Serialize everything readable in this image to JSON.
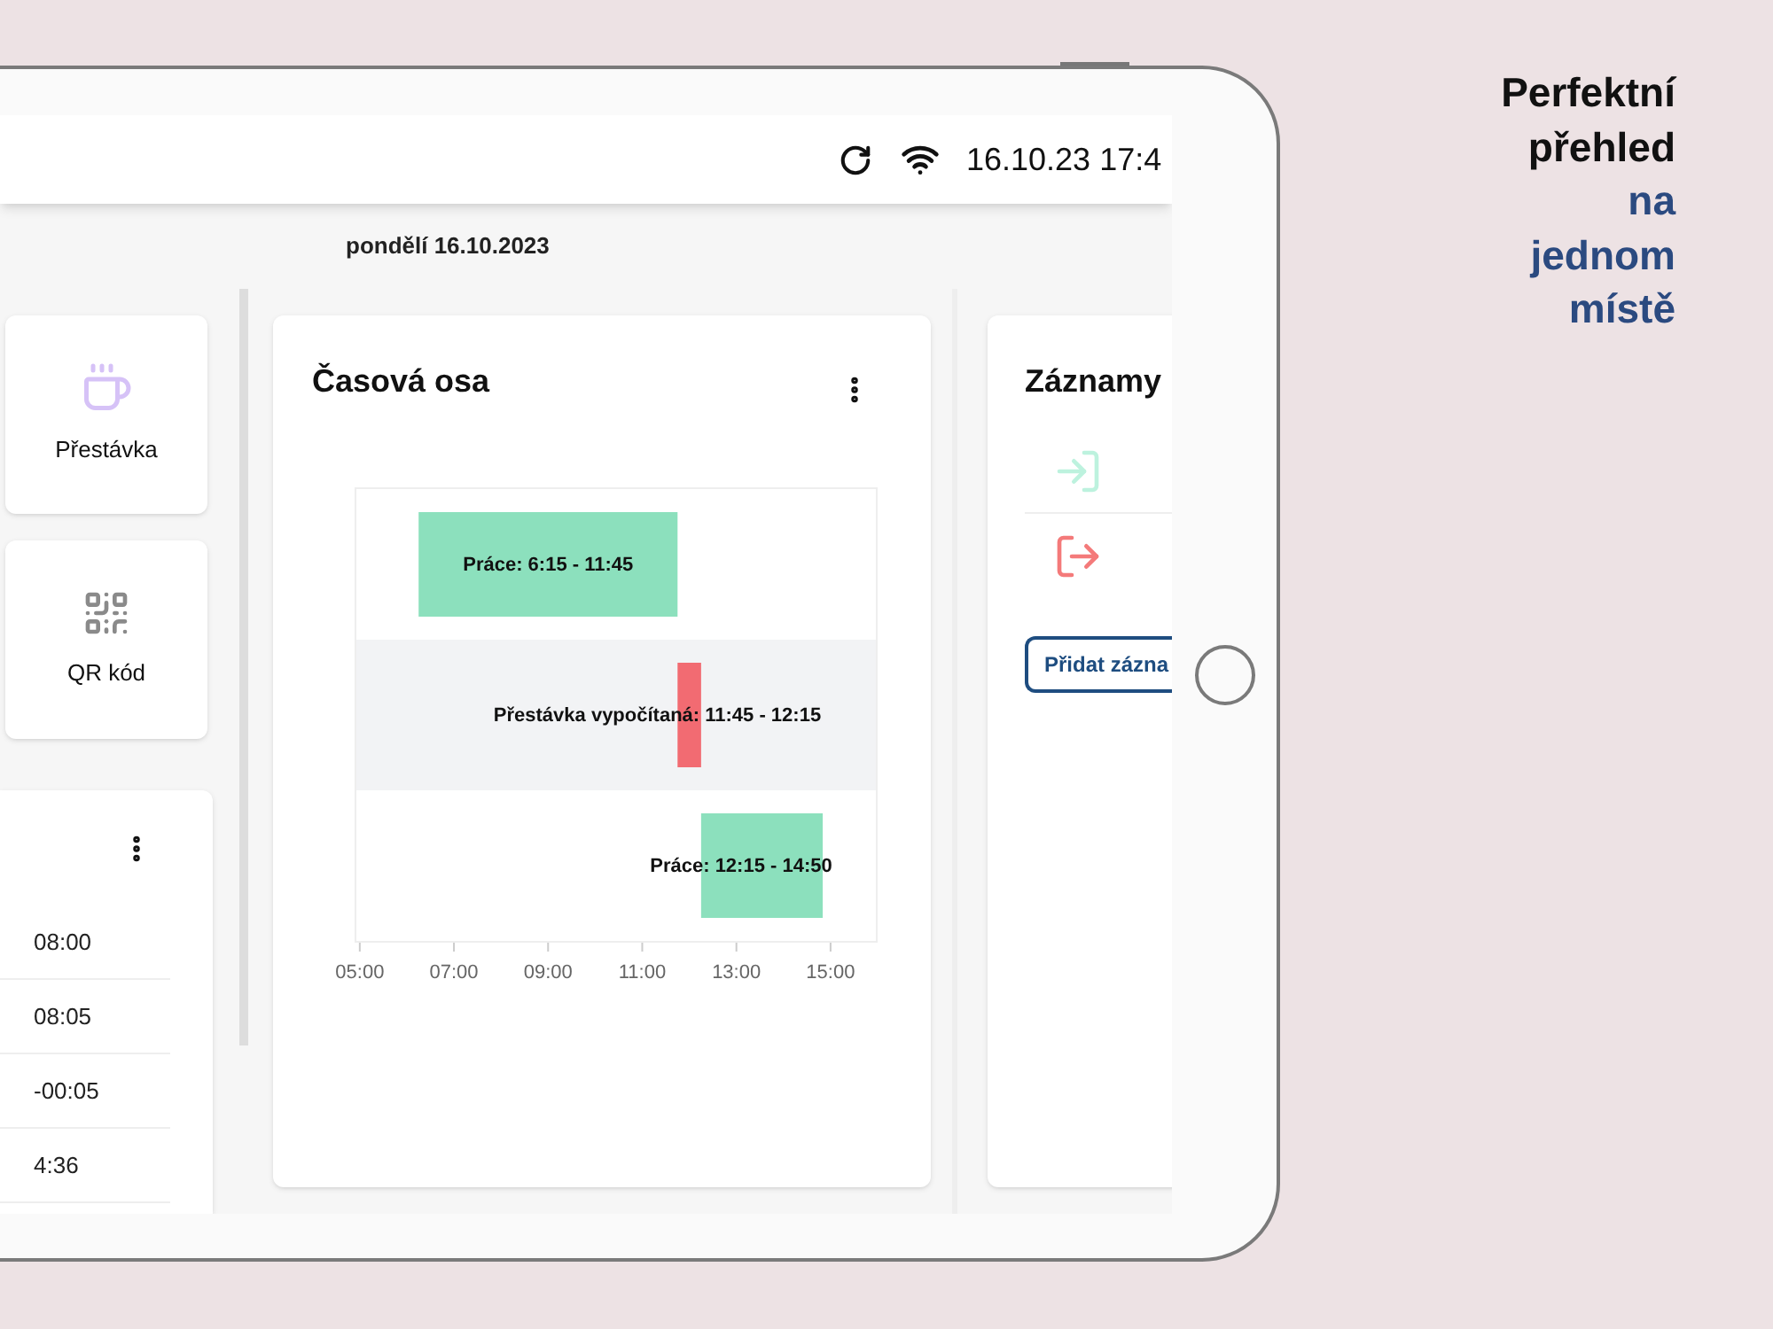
{
  "status_bar": {
    "time": "16.10.23 17:4"
  },
  "date": "pondělí 16.10.2023",
  "actions": [
    {
      "label": "Přestávka",
      "kind": "break"
    },
    {
      "label": "QR kód",
      "kind": "qr"
    }
  ],
  "summary": {
    "values": [
      "08:00",
      "08:05",
      "-00:05",
      "4:36"
    ]
  },
  "timeline": {
    "title": "Časová osa",
    "ticks": [
      "05:00",
      "07:00",
      "09:00",
      "11:00",
      "13:00",
      "15:00"
    ],
    "segments": [
      {
        "label": "Práce: 6:15 - 11:45",
        "color": "#8ce0bd"
      },
      {
        "label": "Přestávka vypočítaná: 11:45 - 12:15",
        "color": "#f26b72"
      },
      {
        "label": "Práce: 12:15 - 14:50",
        "color": "#8ce0bd"
      }
    ]
  },
  "records": {
    "title": "Záznamy",
    "entries": [
      {
        "kind": "in"
      },
      {
        "kind": "out"
      }
    ],
    "add_button": "Přidat zázna"
  },
  "headline": [
    {
      "text": "Perfektní",
      "accent": false
    },
    {
      "text": "přehled",
      "accent": false
    },
    {
      "text": "na",
      "accent": true
    },
    {
      "text": "jednom",
      "accent": true
    },
    {
      "text": "místě",
      "accent": true
    }
  ]
}
